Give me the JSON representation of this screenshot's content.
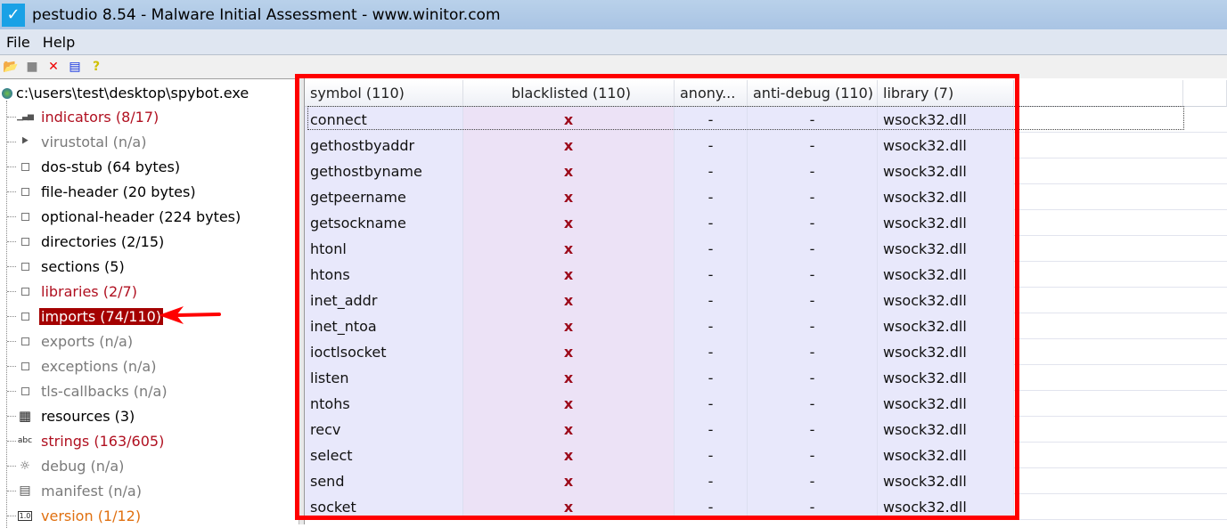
{
  "window": {
    "title": "pestudio 8.54 - Malware Initial Assessment - www.winitor.com"
  },
  "menu": [
    "File",
    "Help"
  ],
  "toolbar": [
    "open-icon",
    "save-icon",
    "close-file-icon",
    "clipboard-icon",
    "help-icon"
  ],
  "tree": {
    "root": "c:\\users\\test\\desktop\\spybot.exe",
    "items": [
      {
        "label": "indicators (8/17)",
        "style": "red",
        "icon": "bars"
      },
      {
        "label": "virustotal (n/a)",
        "style": "gray",
        "icon": "vt"
      },
      {
        "label": "dos-stub (64 bytes)",
        "style": "blk",
        "icon": "box"
      },
      {
        "label": "file-header (20 bytes)",
        "style": "blk",
        "icon": "box"
      },
      {
        "label": "optional-header (224 bytes)",
        "style": "blk",
        "icon": "box"
      },
      {
        "label": "directories (2/15)",
        "style": "blk",
        "icon": "box"
      },
      {
        "label": "sections (5)",
        "style": "blk",
        "icon": "box"
      },
      {
        "label": "libraries (2/7)",
        "style": "red",
        "icon": "box"
      },
      {
        "label": "imports (74/110)",
        "style": "sel",
        "icon": "box"
      },
      {
        "label": "exports (n/a)",
        "style": "gray",
        "icon": "box"
      },
      {
        "label": "exceptions (n/a)",
        "style": "gray",
        "icon": "box"
      },
      {
        "label": "tls-callbacks (n/a)",
        "style": "gray",
        "icon": "box"
      },
      {
        "label": "resources (3)",
        "style": "blk",
        "icon": "grid"
      },
      {
        "label": "strings (163/605)",
        "style": "red",
        "icon": "abc"
      },
      {
        "label": "debug (n/a)",
        "style": "gray",
        "icon": "bug"
      },
      {
        "label": "manifest (n/a)",
        "style": "gray",
        "icon": "scroll"
      },
      {
        "label": "version (1/12)",
        "style": "orange",
        "icon": "ver"
      }
    ]
  },
  "table": {
    "headers": [
      "symbol (110)",
      "blacklisted (110)",
      "anony...",
      "anti-debug (110)",
      "library (7)"
    ],
    "rows": [
      [
        "connect",
        "x",
        "-",
        "-",
        "wsock32.dll"
      ],
      [
        "gethostbyaddr",
        "x",
        "-",
        "-",
        "wsock32.dll"
      ],
      [
        "gethostbyname",
        "x",
        "-",
        "-",
        "wsock32.dll"
      ],
      [
        "getpeername",
        "x",
        "-",
        "-",
        "wsock32.dll"
      ],
      [
        "getsockname",
        "x",
        "-",
        "-",
        "wsock32.dll"
      ],
      [
        "htonl",
        "x",
        "-",
        "-",
        "wsock32.dll"
      ],
      [
        "htons",
        "x",
        "-",
        "-",
        "wsock32.dll"
      ],
      [
        "inet_addr",
        "x",
        "-",
        "-",
        "wsock32.dll"
      ],
      [
        "inet_ntoa",
        "x",
        "-",
        "-",
        "wsock32.dll"
      ],
      [
        "ioctlsocket",
        "x",
        "-",
        "-",
        "wsock32.dll"
      ],
      [
        "listen",
        "x",
        "-",
        "-",
        "wsock32.dll"
      ],
      [
        "ntohs",
        "x",
        "-",
        "-",
        "wsock32.dll"
      ],
      [
        "recv",
        "x",
        "-",
        "-",
        "wsock32.dll"
      ],
      [
        "select",
        "x",
        "-",
        "-",
        "wsock32.dll"
      ],
      [
        "send",
        "x",
        "-",
        "-",
        "wsock32.dll"
      ],
      [
        "socket",
        "x",
        "-",
        "-",
        "wsock32.dll"
      ]
    ]
  },
  "colors": {
    "highlight": "#a40000",
    "annotation": "#ff0000",
    "blacklist_mark": "#9c0a1a"
  }
}
